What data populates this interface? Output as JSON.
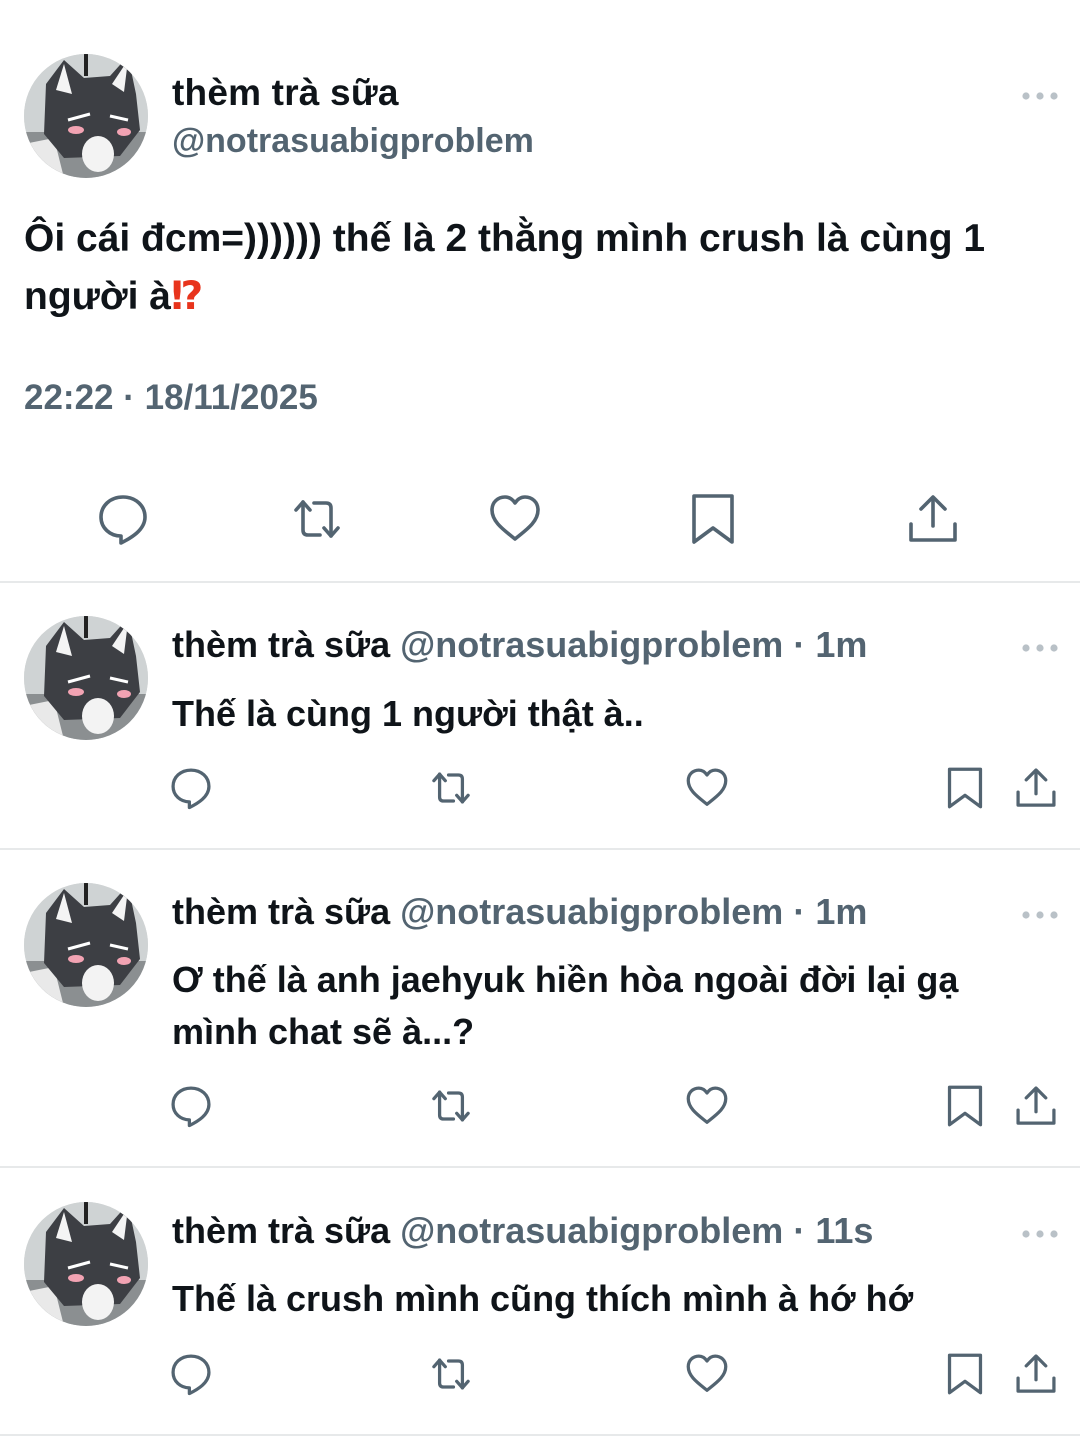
{
  "main_tweet": {
    "display_name": "thèm trà sữa",
    "handle": "@notrasuabigproblem",
    "text": "Ôi cái đcm=)))))) thế là 2 thằng mình crush là cùng 1 người à",
    "emoji": "⁉",
    "timestamp": "22:22 · 18/11/2025",
    "avatar_icon": "cat-avatar-icon",
    "actions": [
      "reply-icon",
      "retweet-icon",
      "like-icon",
      "bookmark-icon",
      "share-icon"
    ]
  },
  "replies": [
    {
      "display_name": "thèm trà sữa",
      "handle": "@notrasuabigproblem",
      "separator": "·",
      "age": "1m",
      "text": "Thế là cùng 1 người thật à.."
    },
    {
      "display_name": "thèm trà sữa",
      "handle": "@notrasuabigproblem",
      "separator": "·",
      "age": "1m",
      "text": "Ơ thế là anh jaehyuk hiền hòa ngoài đời lại gạ mình chat sẽ à...?"
    },
    {
      "display_name": "thèm trà sữa",
      "handle": "@notrasuabigproblem",
      "separator": "·",
      "age": "11s",
      "text": "Thế là crush mình cũng thích mình à hớ hớ"
    }
  ],
  "colors": {
    "text": "#0f1419",
    "secondary": "#536471",
    "divider": "#e7e9ea",
    "emoji_red": "#e8341c"
  }
}
